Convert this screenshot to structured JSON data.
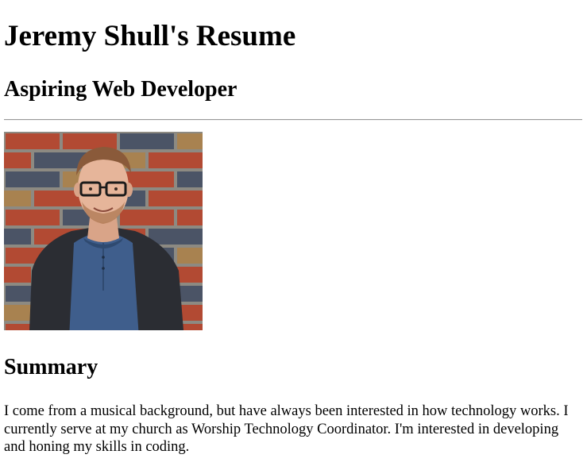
{
  "header": {
    "title": "Jeremy Shull's Resume",
    "subtitle": "Aspiring Web Developer"
  },
  "profile_photo": {
    "alt": "Profile photo",
    "icon": "person-photo"
  },
  "summary": {
    "heading": "Summary",
    "text": "I come from a musical background, but have always been interested in how technology works. I currently serve at my church as Worship Technology Coordinator. I'm interested in developing and honing my skills in coding."
  },
  "colors": {
    "brick_red": "#b24a33",
    "brick_blue": "#4b5466",
    "brick_ochre": "#a88250",
    "mortar": "#8d8a82",
    "shirt_blue": "#3f5e8c",
    "cardigan": "#2b2d33",
    "skin": "#e6b59a",
    "hair": "#8a5a3a"
  }
}
